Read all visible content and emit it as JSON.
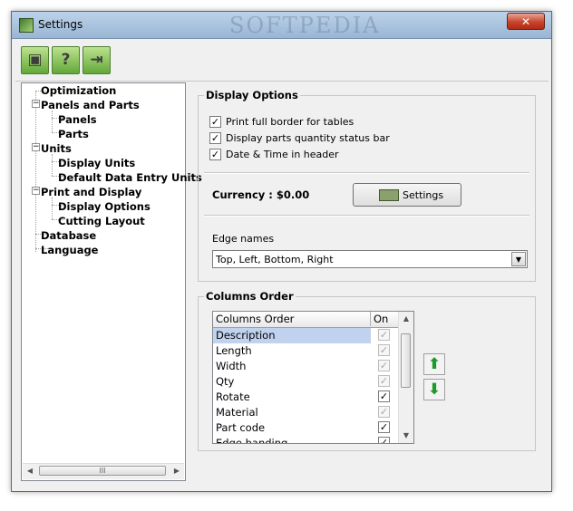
{
  "window": {
    "title": "Settings",
    "watermark": "SOFTPEDIA",
    "close_glyph": "✕"
  },
  "toolbar": {
    "buttons": [
      {
        "icon": "save-icon",
        "glyph": "▣"
      },
      {
        "icon": "help-icon",
        "glyph": "?"
      },
      {
        "icon": "exit-icon",
        "glyph": "⇥"
      }
    ]
  },
  "tree": {
    "items": [
      {
        "label": "Optimization",
        "level": 0,
        "expander": ""
      },
      {
        "label": "Panels and Parts",
        "level": 0,
        "expander": "−"
      },
      {
        "label": "Panels",
        "level": 1,
        "expander": ""
      },
      {
        "label": "Parts",
        "level": 1,
        "expander": ""
      },
      {
        "label": "Units",
        "level": 0,
        "expander": "−"
      },
      {
        "label": "Display Units",
        "level": 1,
        "expander": ""
      },
      {
        "label": "Default Data Entry Units",
        "level": 1,
        "expander": ""
      },
      {
        "label": "Print and Display",
        "level": 0,
        "expander": "−"
      },
      {
        "label": "Display Options",
        "level": 1,
        "expander": ""
      },
      {
        "label": "Cutting Layout",
        "level": 1,
        "expander": ""
      },
      {
        "label": "Database",
        "level": 0,
        "expander": ""
      },
      {
        "label": "Language",
        "level": 0,
        "expander": ""
      }
    ],
    "scroll_left": "◀",
    "scroll_right": "▶",
    "scroll_grip": "III"
  },
  "display_options": {
    "title": "Display Options",
    "checkboxes": [
      {
        "label": "Print full border for tables",
        "checked": true
      },
      {
        "label": "Display parts quantity status bar",
        "checked": true
      },
      {
        "label": "Date & Time in header",
        "checked": true
      }
    ],
    "currency_label": "Currency : $0.00",
    "settings_button": "Settings",
    "edge_names_label": "Edge names",
    "edge_names_value": "Top, Left, Bottom, Right",
    "combo_arrow": "▼"
  },
  "columns_order": {
    "title": "Columns Order",
    "headers": {
      "name": "Columns Order",
      "on": "On"
    },
    "rows": [
      {
        "name": "Description",
        "on": true,
        "enabled": false,
        "selected": true
      },
      {
        "name": "Length",
        "on": true,
        "enabled": false,
        "selected": false
      },
      {
        "name": "Width",
        "on": true,
        "enabled": false,
        "selected": false
      },
      {
        "name": "Qty",
        "on": true,
        "enabled": false,
        "selected": false
      },
      {
        "name": "Rotate",
        "on": true,
        "enabled": true,
        "selected": false
      },
      {
        "name": "Material",
        "on": true,
        "enabled": false,
        "selected": false
      },
      {
        "name": "Part code",
        "on": true,
        "enabled": true,
        "selected": false
      },
      {
        "name": "Edge banding",
        "on": true,
        "enabled": true,
        "selected": false
      }
    ],
    "check_glyph": "✓",
    "scroll_up": "▲",
    "scroll_down": "▼",
    "move_up_glyph": "⬆",
    "move_down_glyph": "⬇"
  },
  "colors": {
    "selection": "#c1d2ee",
    "move_arrow": "#1d9a2a"
  }
}
